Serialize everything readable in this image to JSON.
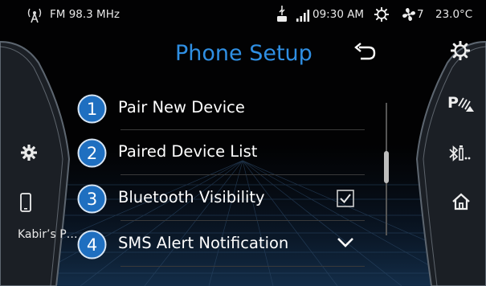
{
  "status_bar": {
    "radio_icon": "radio-signal-icon",
    "radio": "FM 98.3 MHz",
    "usb_icon": "usb-icon",
    "signal_icon": "signal-bars-icon",
    "time": "09:30 AM",
    "climate_icon": "climate-icon",
    "fan_icon": "fan-icon",
    "fan_speed": "7",
    "temperature": "23.0°C"
  },
  "header": {
    "title": "Phone Setup",
    "back_icon": "back-arrow-icon"
  },
  "menu": {
    "items": [
      {
        "number": "1",
        "label": "Pair New Device"
      },
      {
        "number": "2",
        "label": "Paired Device List"
      },
      {
        "number": "3",
        "label": "Bluetooth Visibility",
        "control": "checkbox",
        "checked": true
      },
      {
        "number": "4",
        "label": "SMS Alert Notification",
        "control": "dropdown"
      }
    ]
  },
  "left_panel": {
    "settings_icon": "settings-gear-icon",
    "phone_icon": "phone-icon",
    "device_name": "Kabir’s P…"
  },
  "right_panel": {
    "items": [
      "settings-icon",
      "parking-sensor-icon",
      "bluetooth-audio-icon",
      "home-icon"
    ]
  },
  "colors": {
    "accent": "#2f8fe3",
    "number_badge": "#1f6fc0",
    "background": "#020203"
  }
}
